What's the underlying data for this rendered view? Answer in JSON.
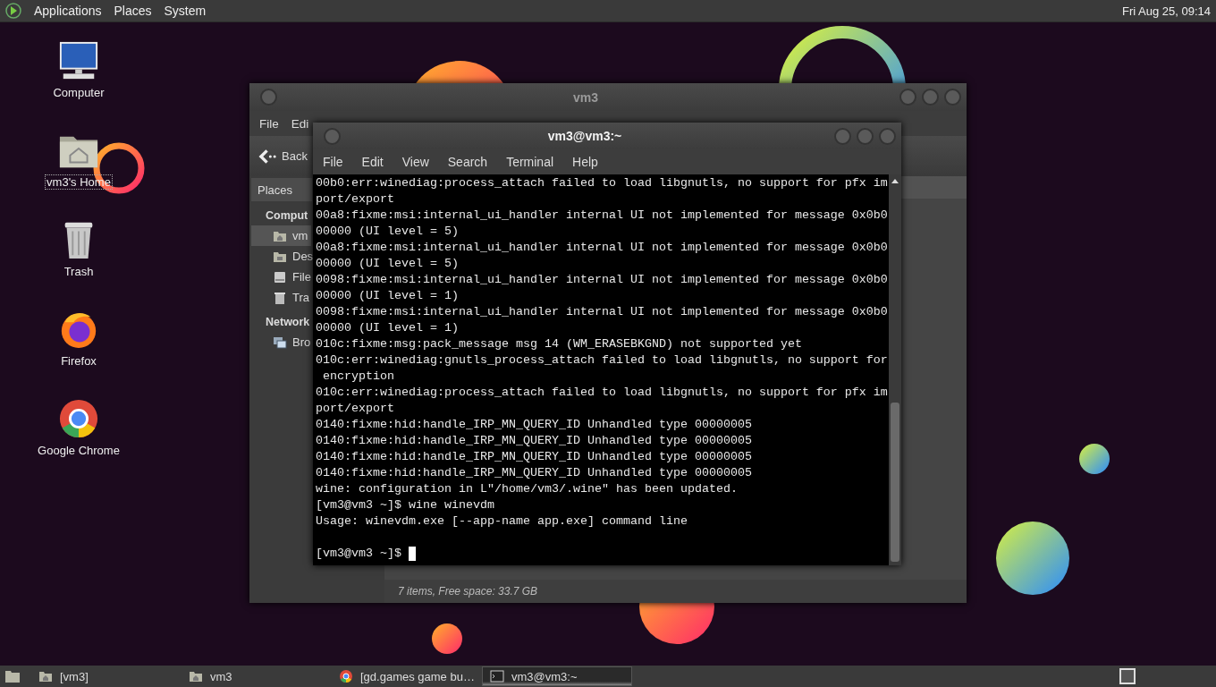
{
  "top_panel": {
    "menus": [
      "Applications",
      "Places",
      "System"
    ],
    "clock": "Fri Aug 25, 09:14"
  },
  "desktop_icons": [
    {
      "kind": "computer",
      "label": "Computer",
      "selected": false
    },
    {
      "kind": "home",
      "label": "vm3's Home",
      "selected": true
    },
    {
      "kind": "trash",
      "label": "Trash",
      "selected": false
    },
    {
      "kind": "firefox",
      "label": "Firefox",
      "selected": false
    },
    {
      "kind": "chrome",
      "label": "Google Chrome",
      "selected": false
    }
  ],
  "file_manager": {
    "title": "vm3",
    "menus": [
      "File",
      "Edi"
    ],
    "back": "Back",
    "sidebar_header": "Places",
    "sections": [
      {
        "label": "Comput",
        "items": [
          {
            "kind": "home",
            "label": "vm",
            "selected": true
          },
          {
            "kind": "desktop",
            "label": "Des",
            "selected": false
          },
          {
            "kind": "drive",
            "label": "File",
            "selected": false
          },
          {
            "kind": "trash",
            "label": "Tra",
            "selected": false
          }
        ]
      },
      {
        "label": "Network",
        "items": [
          {
            "kind": "network",
            "label": "Bro",
            "selected": false
          }
        ]
      }
    ],
    "status": "7 items, Free space: 33.7 GB"
  },
  "terminal": {
    "title": "vm3@vm3:~",
    "menus": [
      "File",
      "Edit",
      "View",
      "Search",
      "Terminal",
      "Help"
    ],
    "lines": [
      "00b0:err:winediag:process_attach failed to load libgnutls, no support for pfx im",
      "port/export",
      "00a8:fixme:msi:internal_ui_handler internal UI not implemented for message 0x0b0",
      "00000 (UI level = 5)",
      "00a8:fixme:msi:internal_ui_handler internal UI not implemented for message 0x0b0",
      "00000 (UI level = 5)",
      "0098:fixme:msi:internal_ui_handler internal UI not implemented for message 0x0b0",
      "00000 (UI level = 1)",
      "0098:fixme:msi:internal_ui_handler internal UI not implemented for message 0x0b0",
      "00000 (UI level = 1)",
      "010c:fixme:msg:pack_message msg 14 (WM_ERASEBKGND) not supported yet",
      "010c:err:winediag:gnutls_process_attach failed to load libgnutls, no support for",
      " encryption",
      "010c:err:winediag:process_attach failed to load libgnutls, no support for pfx im",
      "port/export",
      "0140:fixme:hid:handle_IRP_MN_QUERY_ID Unhandled type 00000005",
      "0140:fixme:hid:handle_IRP_MN_QUERY_ID Unhandled type 00000005",
      "0140:fixme:hid:handle_IRP_MN_QUERY_ID Unhandled type 00000005",
      "0140:fixme:hid:handle_IRP_MN_QUERY_ID Unhandled type 00000005",
      "wine: configuration in L\"/home/vm3/.wine\" has been updated.",
      "[vm3@vm3 ~]$ wine winevdm",
      "Usage: winevdm.exe [--app-name app.exe] command line"
    ],
    "prompt": "[vm3@vm3 ~]$"
  },
  "taskbar": {
    "items": [
      {
        "kind": "folder",
        "label": "[vm3]",
        "selected": false
      },
      {
        "kind": "folder",
        "label": "vm3",
        "selected": false
      },
      {
        "kind": "chrome",
        "label": "[gd.games game bu…",
        "selected": false
      },
      {
        "kind": "terminal",
        "label": "vm3@vm3:~",
        "selected": true
      }
    ]
  }
}
